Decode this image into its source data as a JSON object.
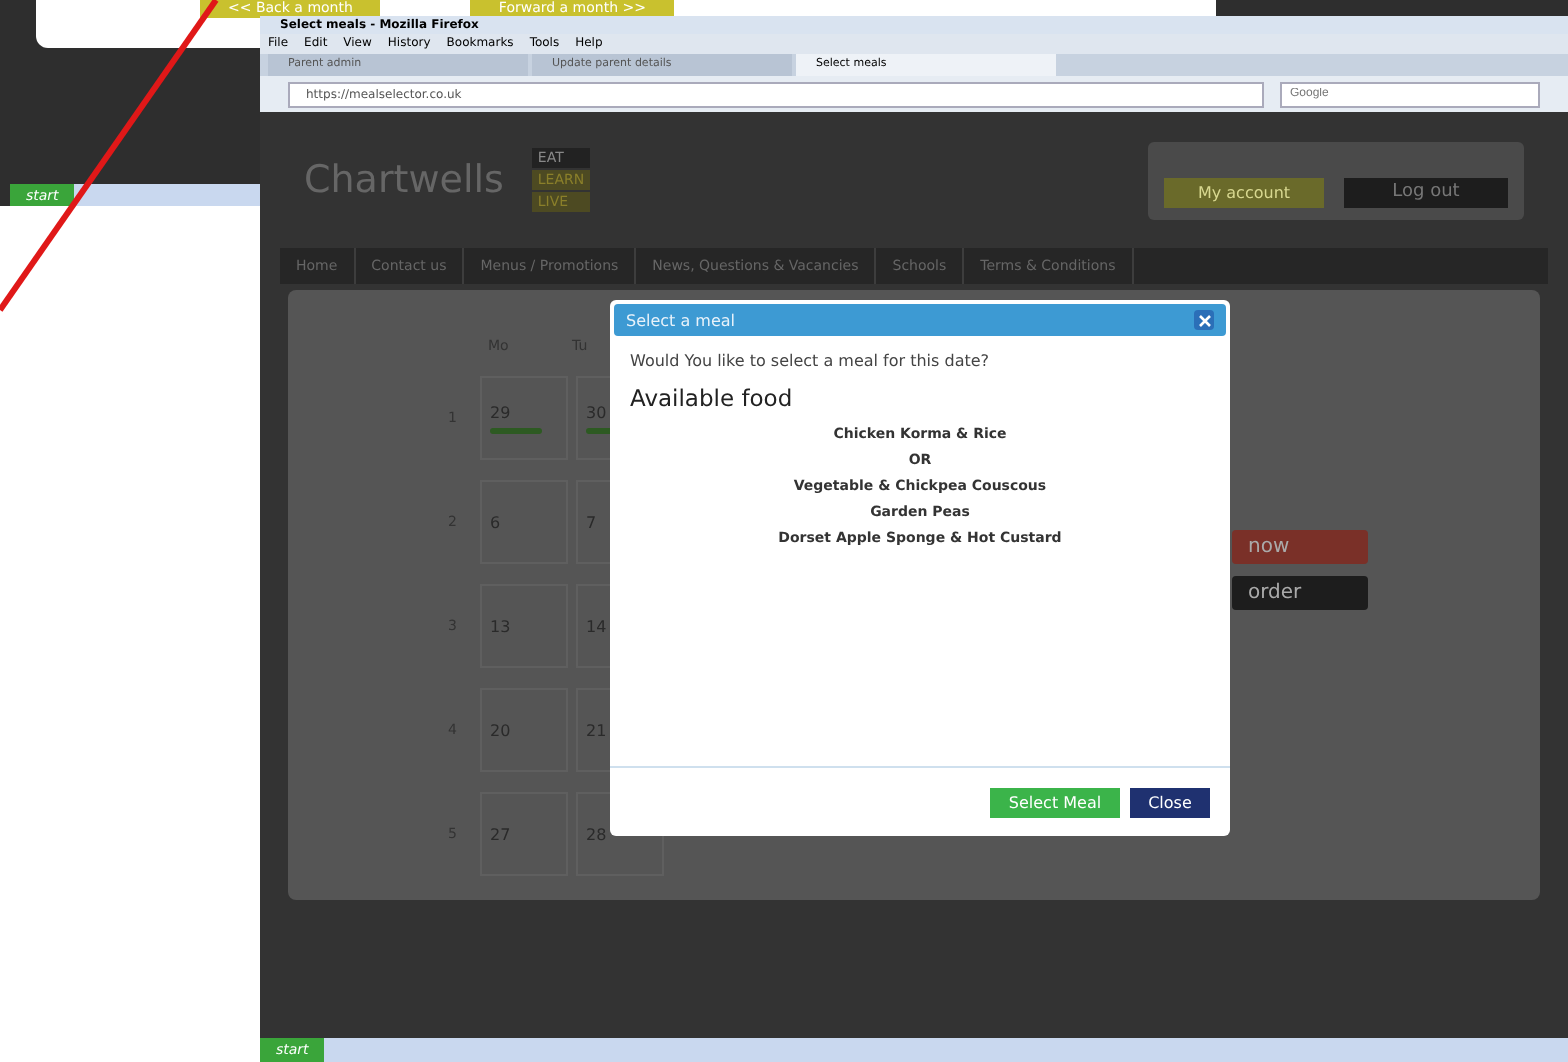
{
  "back_window": {
    "buttons": [
      "<< Back a month",
      "Forward a month >>"
    ],
    "taskbar": {
      "start": "start"
    }
  },
  "browser": {
    "title": "Select meals - Mozilla Firefox",
    "menu": [
      "File",
      "Edit",
      "View",
      "History",
      "Bookmarks",
      "Tools",
      "Help"
    ],
    "tabs": [
      {
        "label": "Parent admin",
        "selected": false
      },
      {
        "label": "Update parent details",
        "selected": false
      },
      {
        "label": "Select meals",
        "selected": true
      }
    ],
    "address": "https://mealselector.co.uk",
    "search": {
      "placeholder": "Google"
    },
    "taskbar": {
      "start": "start"
    }
  },
  "site": {
    "logo": "Chartwells",
    "motto": [
      "EAT",
      "LEARN",
      "LIVE"
    ],
    "account_button": "My account",
    "logout_button": "Log out",
    "nav": [
      "Home",
      "Contact us",
      "Menus / Promotions",
      "News, Questions & Vacancies",
      "Schools",
      "Terms & Conditions"
    ],
    "calendar": {
      "columns": [
        "Mo",
        "Tu"
      ],
      "weeks": [
        {
          "week": "1",
          "days": [
            "29",
            "30"
          ],
          "booked": true
        },
        {
          "week": "2",
          "days": [
            "6",
            "7"
          ],
          "booked": false
        },
        {
          "week": "3",
          "days": [
            "13",
            "14"
          ],
          "booked": false
        },
        {
          "week": "4",
          "days": [
            "20",
            "21"
          ],
          "booked": false
        },
        {
          "week": "5",
          "days": [
            "27",
            "28"
          ],
          "booked": false
        }
      ]
    },
    "side_buttons": [
      {
        "label": "now",
        "kind": "red"
      },
      {
        "label": "order",
        "kind": "dark"
      }
    ]
  },
  "dialog": {
    "title": "Select a meal",
    "question": "Would You like to select a meal for this date?",
    "heading": "Available food",
    "items": [
      "Chicken Korma & Rice",
      "OR",
      "Vegetable & Chickpea Couscous",
      "Garden Peas",
      "Dorset Apple Sponge & Hot Custard"
    ],
    "buttons": [
      {
        "label": "Select Meal",
        "kind": "primary"
      },
      {
        "label": "Close",
        "kind": "secondary"
      }
    ]
  }
}
